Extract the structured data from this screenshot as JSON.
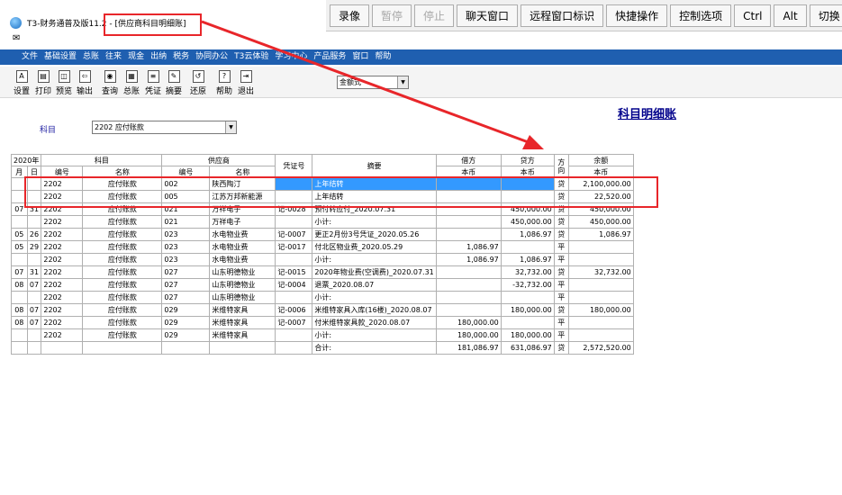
{
  "window": {
    "title": "T3-财务通普及版11.2 - [供应商科目明细账]"
  },
  "remote_toolbar": {
    "buttons": [
      {
        "label": "录像",
        "enabled": true
      },
      {
        "label": "暂停",
        "enabled": false
      },
      {
        "label": "停止",
        "enabled": false
      },
      {
        "label": "聊天窗口",
        "enabled": true
      },
      {
        "label": "远程窗口标识",
        "enabled": true
      },
      {
        "label": "快捷操作",
        "enabled": true
      },
      {
        "label": "控制选项",
        "enabled": true
      },
      {
        "label": "Ctrl",
        "enabled": true
      },
      {
        "label": "Alt",
        "enabled": true
      },
      {
        "label": "切换",
        "enabled": true
      }
    ]
  },
  "menu": [
    "文件",
    "基础设置",
    "总账",
    "往来",
    "现金",
    "出纳",
    "税务",
    "协同办公",
    "T3云体验",
    "学习中心",
    "产品服务",
    "窗口",
    "帮助"
  ],
  "toolbar": {
    "tools": [
      {
        "label": "设置",
        "icon": "A"
      },
      {
        "label": "打印",
        "icon": "▤"
      },
      {
        "label": "预览",
        "icon": "◫"
      },
      {
        "label": "输出",
        "icon": "⇦"
      },
      {
        "label": "查询",
        "icon": "◉"
      },
      {
        "label": "总账",
        "icon": "▦"
      },
      {
        "label": "凭证",
        "icon": "≡"
      },
      {
        "label": "摘要",
        "icon": "✎"
      },
      {
        "label": "还原",
        "icon": "↺"
      },
      {
        "label": "帮助",
        "icon": "?"
      },
      {
        "label": "退出",
        "icon": "⇥"
      }
    ],
    "amount_format": "金额式"
  },
  "report": {
    "title": "科目明细账",
    "subject_label": "科目",
    "subject_value": "2202 应付账款"
  },
  "table": {
    "header": {
      "year": "2020年",
      "month": "月",
      "day": "日",
      "subject": "科目",
      "subject_code": "编号",
      "subject_name": "名称",
      "supplier": "供应商",
      "supplier_code": "编号",
      "supplier_name": "名称",
      "voucher": "凭证号",
      "summary": "摘要",
      "debit": "借方",
      "debit_currency": "本币",
      "credit": "贷方",
      "credit_currency": "本币",
      "direction": "方向",
      "balance": "余额",
      "balance_currency": "本币"
    },
    "rows": [
      {
        "m": "",
        "d": "",
        "code": "2202",
        "name": "应付账款",
        "scode": "002",
        "sname": "陕西陶汀",
        "voucher": "",
        "summary": "上年结转",
        "debit": "",
        "credit": "",
        "dir": "贷",
        "balance": "2,100,000.00",
        "selected": true
      },
      {
        "m": "",
        "d": "",
        "code": "2202",
        "name": "应付账款",
        "scode": "005",
        "sname": "江苏万邦新能源",
        "voucher": "",
        "summary": "上年结转",
        "debit": "",
        "credit": "",
        "dir": "贷",
        "balance": "22,520.00",
        "selected": false
      },
      {
        "m": "07",
        "d": "31",
        "code": "2202",
        "name": "应付账款",
        "scode": "021",
        "sname": "万祥电子",
        "voucher": "记-0028",
        "summary": "预付转应付_2020.07.31",
        "debit": "",
        "credit": "450,000.00",
        "dir": "贷",
        "balance": "450,000.00",
        "selected": false
      },
      {
        "m": "",
        "d": "",
        "code": "2202",
        "name": "应付账款",
        "scode": "021",
        "sname": "万祥电子",
        "voucher": "",
        "summary": "小计:",
        "debit": "",
        "credit": "450,000.00",
        "dir": "贷",
        "balance": "450,000.00",
        "selected": false
      },
      {
        "m": "05",
        "d": "26",
        "code": "2202",
        "name": "应付账款",
        "scode": "023",
        "sname": "水电物业费",
        "voucher": "记-0007",
        "summary": "更正2月份3号凭证_2020.05.26",
        "debit": "",
        "credit": "1,086.97",
        "dir": "贷",
        "balance": "1,086.97",
        "selected": false
      },
      {
        "m": "05",
        "d": "29",
        "code": "2202",
        "name": "应付账款",
        "scode": "023",
        "sname": "水电物业费",
        "voucher": "记-0017",
        "summary": "付北区物业费_2020.05.29",
        "debit": "1,086.97",
        "credit": "",
        "dir": "平",
        "balance": "",
        "selected": false
      },
      {
        "m": "",
        "d": "",
        "code": "2202",
        "name": "应付账款",
        "scode": "023",
        "sname": "水电物业费",
        "voucher": "",
        "summary": "小计:",
        "debit": "1,086.97",
        "credit": "1,086.97",
        "dir": "平",
        "balance": "",
        "selected": false
      },
      {
        "m": "07",
        "d": "31",
        "code": "2202",
        "name": "应付账款",
        "scode": "027",
        "sname": "山东明德物业",
        "voucher": "记-0015",
        "summary": "2020年物业费(空调费)_2020.07.31",
        "debit": "",
        "credit": "32,732.00",
        "dir": "贷",
        "balance": "32,732.00",
        "selected": false
      },
      {
        "m": "08",
        "d": "07",
        "code": "2202",
        "name": "应付账款",
        "scode": "027",
        "sname": "山东明德物业",
        "voucher": "记-0004",
        "summary": "退票_2020.08.07",
        "debit": "",
        "credit": "-32,732.00",
        "dir": "平",
        "balance": "",
        "selected": false
      },
      {
        "m": "",
        "d": "",
        "code": "2202",
        "name": "应付账款",
        "scode": "027",
        "sname": "山东明德物业",
        "voucher": "",
        "summary": "小计:",
        "debit": "",
        "credit": "",
        "dir": "平",
        "balance": "",
        "selected": false
      },
      {
        "m": "08",
        "d": "07",
        "code": "2202",
        "name": "应付账款",
        "scode": "029",
        "sname": "米维特家具",
        "voucher": "记-0006",
        "summary": "米维特家具入库(16楼)_2020.08.07",
        "debit": "",
        "credit": "180,000.00",
        "dir": "贷",
        "balance": "180,000.00",
        "selected": false
      },
      {
        "m": "08",
        "d": "07",
        "code": "2202",
        "name": "应付账款",
        "scode": "029",
        "sname": "米维特家具",
        "voucher": "记-0007",
        "summary": "付米维特家具款_2020.08.07",
        "debit": "180,000.00",
        "credit": "",
        "dir": "平",
        "balance": "",
        "selected": false
      },
      {
        "m": "",
        "d": "",
        "code": "2202",
        "name": "应付账款",
        "scode": "029",
        "sname": "米维特家具",
        "voucher": "",
        "summary": "小计:",
        "debit": "180,000.00",
        "credit": "180,000.00",
        "dir": "平",
        "balance": "",
        "selected": false
      },
      {
        "m": "",
        "d": "",
        "code": "",
        "name": "",
        "scode": "",
        "sname": "",
        "voucher": "",
        "summary": "合计:",
        "debit": "181,086.97",
        "credit": "631,086.97",
        "dir": "贷",
        "balance": "2,572,520.00",
        "selected": false
      }
    ]
  },
  "colors": {
    "menu_bar": "#1f5fb0",
    "selection": "#3399ff",
    "annotation": "#e8262a",
    "report_title": "#00008b"
  }
}
